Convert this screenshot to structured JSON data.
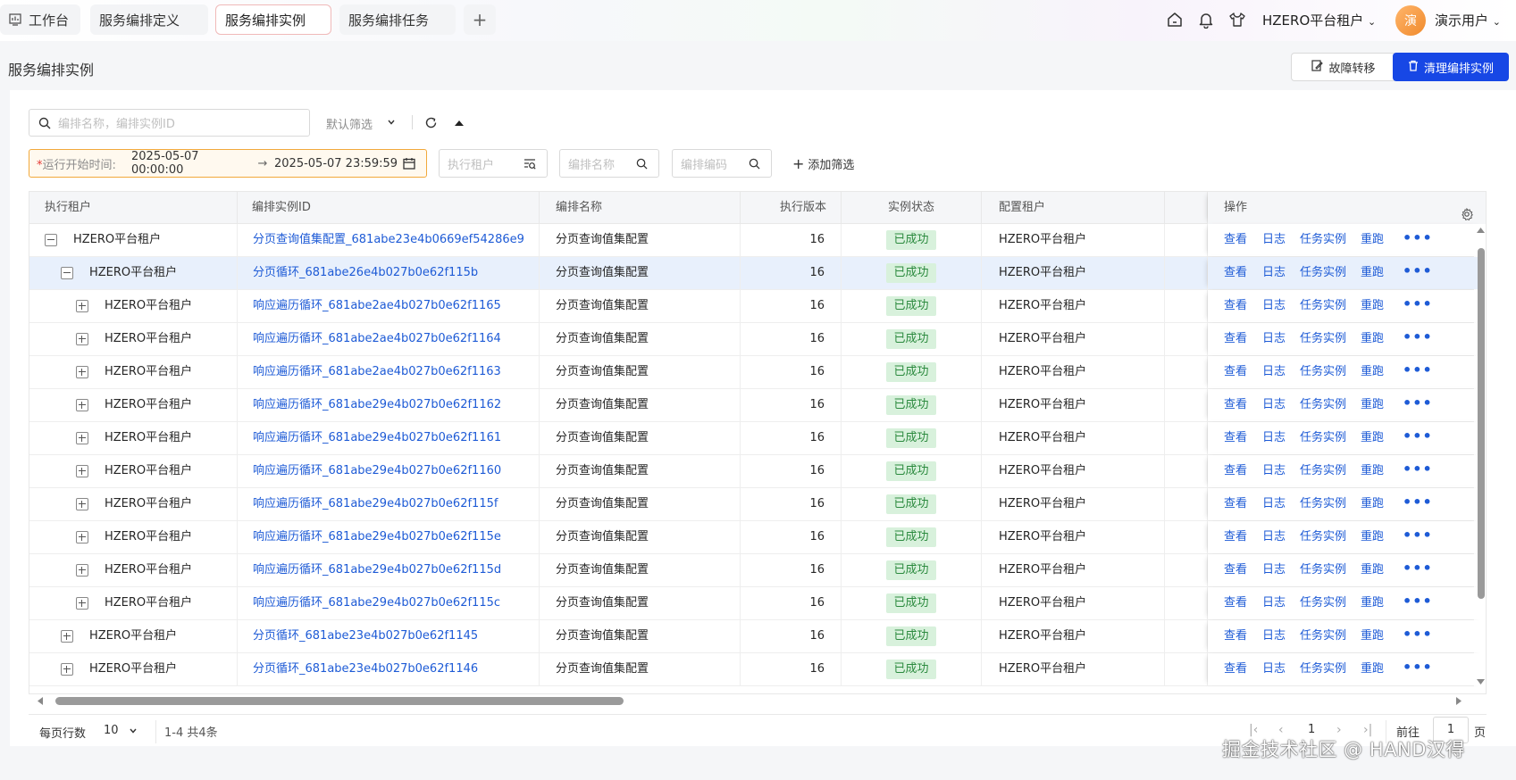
{
  "tabs": [
    {
      "label": "工作台",
      "icon": "dashboard-icon"
    },
    {
      "label": "服务编排定义"
    },
    {
      "label": "服务编排实例",
      "active": true
    },
    {
      "label": "服务编排任务"
    }
  ],
  "header": {
    "tenant": "HZERO平台租户",
    "avatar_text": "演",
    "user": "演示用户"
  },
  "page": {
    "title": "服务编排实例",
    "btn_failover": "故障转移",
    "btn_clean": "清理编排实例"
  },
  "search": {
    "placeholder": "编排名称，编排实例ID",
    "default_filter": "默认筛选"
  },
  "filters": {
    "date_label": "运行开始时间:",
    "date_required": "*",
    "date_start": "2025-05-07 00:00:00",
    "date_arrow": "→",
    "date_end": "2025-05-07 23:59:59",
    "tenant_placeholder": "执行租户",
    "name_placeholder": "编排名称",
    "code_placeholder": "编排编码",
    "add_filter": "添加筛选"
  },
  "columns": [
    "执行租户",
    "编排实例ID",
    "编排名称",
    "执行版本",
    "实例状态",
    "配置租户",
    "操作"
  ],
  "ops": [
    "查看",
    "日志",
    "任务实例",
    "重跑",
    "•••"
  ],
  "rows": [
    {
      "level": 0,
      "toggle": "minus",
      "tenant": "HZERO平台租户",
      "id": "分页查询值集配置_681abe23e4b0669ef54286e9",
      "name": "分页查询值集配置",
      "version": "16",
      "status": "已成功",
      "config_tenant": "HZERO平台租户"
    },
    {
      "level": 1,
      "toggle": "minus",
      "tenant": "HZERO平台租户",
      "id": "分页循环_681abe26e4b027b0e62f115b",
      "name": "分页查询值集配置",
      "version": "16",
      "status": "已成功",
      "config_tenant": "HZERO平台租户",
      "highlight": true
    },
    {
      "level": 2,
      "toggle": "plus",
      "tenant": "HZERO平台租户",
      "id": "响应遍历循环_681abe2ae4b027b0e62f1165",
      "name": "分页查询值集配置",
      "version": "16",
      "status": "已成功",
      "config_tenant": "HZERO平台租户"
    },
    {
      "level": 2,
      "toggle": "plus",
      "tenant": "HZERO平台租户",
      "id": "响应遍历循环_681abe2ae4b027b0e62f1164",
      "name": "分页查询值集配置",
      "version": "16",
      "status": "已成功",
      "config_tenant": "HZERO平台租户"
    },
    {
      "level": 2,
      "toggle": "plus",
      "tenant": "HZERO平台租户",
      "id": "响应遍历循环_681abe2ae4b027b0e62f1163",
      "name": "分页查询值集配置",
      "version": "16",
      "status": "已成功",
      "config_tenant": "HZERO平台租户"
    },
    {
      "level": 2,
      "toggle": "plus",
      "tenant": "HZERO平台租户",
      "id": "响应遍历循环_681abe29e4b027b0e62f1162",
      "name": "分页查询值集配置",
      "version": "16",
      "status": "已成功",
      "config_tenant": "HZERO平台租户"
    },
    {
      "level": 2,
      "toggle": "plus",
      "tenant": "HZERO平台租户",
      "id": "响应遍历循环_681abe29e4b027b0e62f1161",
      "name": "分页查询值集配置",
      "version": "16",
      "status": "已成功",
      "config_tenant": "HZERO平台租户"
    },
    {
      "level": 2,
      "toggle": "plus",
      "tenant": "HZERO平台租户",
      "id": "响应遍历循环_681abe29e4b027b0e62f1160",
      "name": "分页查询值集配置",
      "version": "16",
      "status": "已成功",
      "config_tenant": "HZERO平台租户"
    },
    {
      "level": 2,
      "toggle": "plus",
      "tenant": "HZERO平台租户",
      "id": "响应遍历循环_681abe29e4b027b0e62f115f",
      "name": "分页查询值集配置",
      "version": "16",
      "status": "已成功",
      "config_tenant": "HZERO平台租户"
    },
    {
      "level": 2,
      "toggle": "plus",
      "tenant": "HZERO平台租户",
      "id": "响应遍历循环_681abe29e4b027b0e62f115e",
      "name": "分页查询值集配置",
      "version": "16",
      "status": "已成功",
      "config_tenant": "HZERO平台租户"
    },
    {
      "level": 2,
      "toggle": "plus",
      "tenant": "HZERO平台租户",
      "id": "响应遍历循环_681abe29e4b027b0e62f115d",
      "name": "分页查询值集配置",
      "version": "16",
      "status": "已成功",
      "config_tenant": "HZERO平台租户"
    },
    {
      "level": 2,
      "toggle": "plus",
      "tenant": "HZERO平台租户",
      "id": "响应遍历循环_681abe29e4b027b0e62f115c",
      "name": "分页查询值集配置",
      "version": "16",
      "status": "已成功",
      "config_tenant": "HZERO平台租户"
    },
    {
      "level": 1,
      "toggle": "plus",
      "tenant": "HZERO平台租户",
      "id": "分页循环_681abe23e4b027b0e62f1145",
      "name": "分页查询值集配置",
      "version": "16",
      "status": "已成功",
      "config_tenant": "HZERO平台租户"
    },
    {
      "level": 1,
      "toggle": "plus",
      "tenant": "HZERO平台租户",
      "id": "分页循环_681abe23e4b027b0e62f1146",
      "name": "分页查询值集配置",
      "version": "16",
      "status": "已成功",
      "config_tenant": "HZERO平台租户"
    }
  ],
  "pagination": {
    "rows_per_page_label": "每页行数",
    "rows_per_page": "10",
    "info": "1-4  共4条",
    "first": "K",
    "prev": "‹",
    "current": "1",
    "next": "›",
    "last": "K",
    "goto_label": "前往",
    "goto_value": "1",
    "page_suffix": "页"
  },
  "watermark": "掘金技术社区 @ HAND汉得",
  "colors": {
    "primary": "#1747e5",
    "link": "#1e5bd6",
    "success_bg": "#d8f1dc",
    "success_text": "#2b8a3e",
    "warning_border": "#f2a93b"
  }
}
